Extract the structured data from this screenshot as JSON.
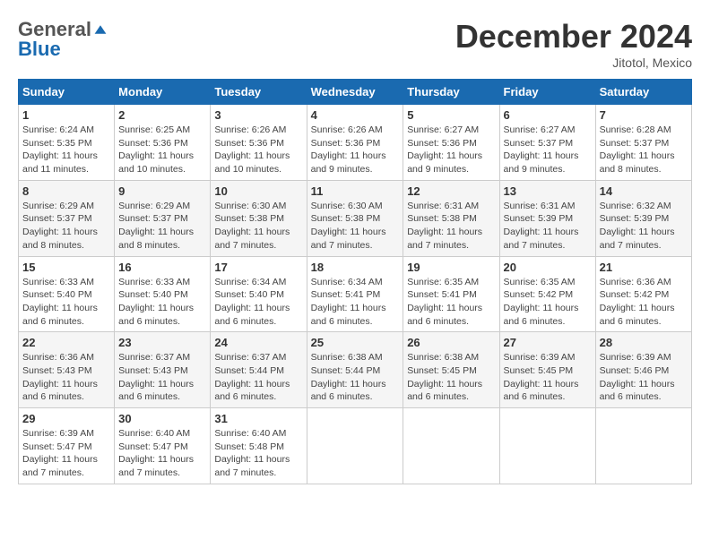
{
  "logo": {
    "general": "General",
    "blue": "Blue"
  },
  "title": "December 2024",
  "location": "Jitotol, Mexico",
  "days_of_week": [
    "Sunday",
    "Monday",
    "Tuesday",
    "Wednesday",
    "Thursday",
    "Friday",
    "Saturday"
  ],
  "weeks": [
    [
      {
        "day": 1,
        "sunrise": "6:24 AM",
        "sunset": "5:35 PM",
        "daylight": "11 hours and 11 minutes."
      },
      {
        "day": 2,
        "sunrise": "6:25 AM",
        "sunset": "5:36 PM",
        "daylight": "11 hours and 10 minutes."
      },
      {
        "day": 3,
        "sunrise": "6:26 AM",
        "sunset": "5:36 PM",
        "daylight": "11 hours and 10 minutes."
      },
      {
        "day": 4,
        "sunrise": "6:26 AM",
        "sunset": "5:36 PM",
        "daylight": "11 hours and 9 minutes."
      },
      {
        "day": 5,
        "sunrise": "6:27 AM",
        "sunset": "5:36 PM",
        "daylight": "11 hours and 9 minutes."
      },
      {
        "day": 6,
        "sunrise": "6:27 AM",
        "sunset": "5:37 PM",
        "daylight": "11 hours and 9 minutes."
      },
      {
        "day": 7,
        "sunrise": "6:28 AM",
        "sunset": "5:37 PM",
        "daylight": "11 hours and 8 minutes."
      }
    ],
    [
      {
        "day": 8,
        "sunrise": "6:29 AM",
        "sunset": "5:37 PM",
        "daylight": "11 hours and 8 minutes."
      },
      {
        "day": 9,
        "sunrise": "6:29 AM",
        "sunset": "5:37 PM",
        "daylight": "11 hours and 8 minutes."
      },
      {
        "day": 10,
        "sunrise": "6:30 AM",
        "sunset": "5:38 PM",
        "daylight": "11 hours and 7 minutes."
      },
      {
        "day": 11,
        "sunrise": "6:30 AM",
        "sunset": "5:38 PM",
        "daylight": "11 hours and 7 minutes."
      },
      {
        "day": 12,
        "sunrise": "6:31 AM",
        "sunset": "5:38 PM",
        "daylight": "11 hours and 7 minutes."
      },
      {
        "day": 13,
        "sunrise": "6:31 AM",
        "sunset": "5:39 PM",
        "daylight": "11 hours and 7 minutes."
      },
      {
        "day": 14,
        "sunrise": "6:32 AM",
        "sunset": "5:39 PM",
        "daylight": "11 hours and 7 minutes."
      }
    ],
    [
      {
        "day": 15,
        "sunrise": "6:33 AM",
        "sunset": "5:40 PM",
        "daylight": "11 hours and 6 minutes."
      },
      {
        "day": 16,
        "sunrise": "6:33 AM",
        "sunset": "5:40 PM",
        "daylight": "11 hours and 6 minutes."
      },
      {
        "day": 17,
        "sunrise": "6:34 AM",
        "sunset": "5:40 PM",
        "daylight": "11 hours and 6 minutes."
      },
      {
        "day": 18,
        "sunrise": "6:34 AM",
        "sunset": "5:41 PM",
        "daylight": "11 hours and 6 minutes."
      },
      {
        "day": 19,
        "sunrise": "6:35 AM",
        "sunset": "5:41 PM",
        "daylight": "11 hours and 6 minutes."
      },
      {
        "day": 20,
        "sunrise": "6:35 AM",
        "sunset": "5:42 PM",
        "daylight": "11 hours and 6 minutes."
      },
      {
        "day": 21,
        "sunrise": "6:36 AM",
        "sunset": "5:42 PM",
        "daylight": "11 hours and 6 minutes."
      }
    ],
    [
      {
        "day": 22,
        "sunrise": "6:36 AM",
        "sunset": "5:43 PM",
        "daylight": "11 hours and 6 minutes."
      },
      {
        "day": 23,
        "sunrise": "6:37 AM",
        "sunset": "5:43 PM",
        "daylight": "11 hours and 6 minutes."
      },
      {
        "day": 24,
        "sunrise": "6:37 AM",
        "sunset": "5:44 PM",
        "daylight": "11 hours and 6 minutes."
      },
      {
        "day": 25,
        "sunrise": "6:38 AM",
        "sunset": "5:44 PM",
        "daylight": "11 hours and 6 minutes."
      },
      {
        "day": 26,
        "sunrise": "6:38 AM",
        "sunset": "5:45 PM",
        "daylight": "11 hours and 6 minutes."
      },
      {
        "day": 27,
        "sunrise": "6:39 AM",
        "sunset": "5:45 PM",
        "daylight": "11 hours and 6 minutes."
      },
      {
        "day": 28,
        "sunrise": "6:39 AM",
        "sunset": "5:46 PM",
        "daylight": "11 hours and 6 minutes."
      }
    ],
    [
      {
        "day": 29,
        "sunrise": "6:39 AM",
        "sunset": "5:47 PM",
        "daylight": "11 hours and 7 minutes."
      },
      {
        "day": 30,
        "sunrise": "6:40 AM",
        "sunset": "5:47 PM",
        "daylight": "11 hours and 7 minutes."
      },
      {
        "day": 31,
        "sunrise": "6:40 AM",
        "sunset": "5:48 PM",
        "daylight": "11 hours and 7 minutes."
      },
      null,
      null,
      null,
      null
    ]
  ]
}
